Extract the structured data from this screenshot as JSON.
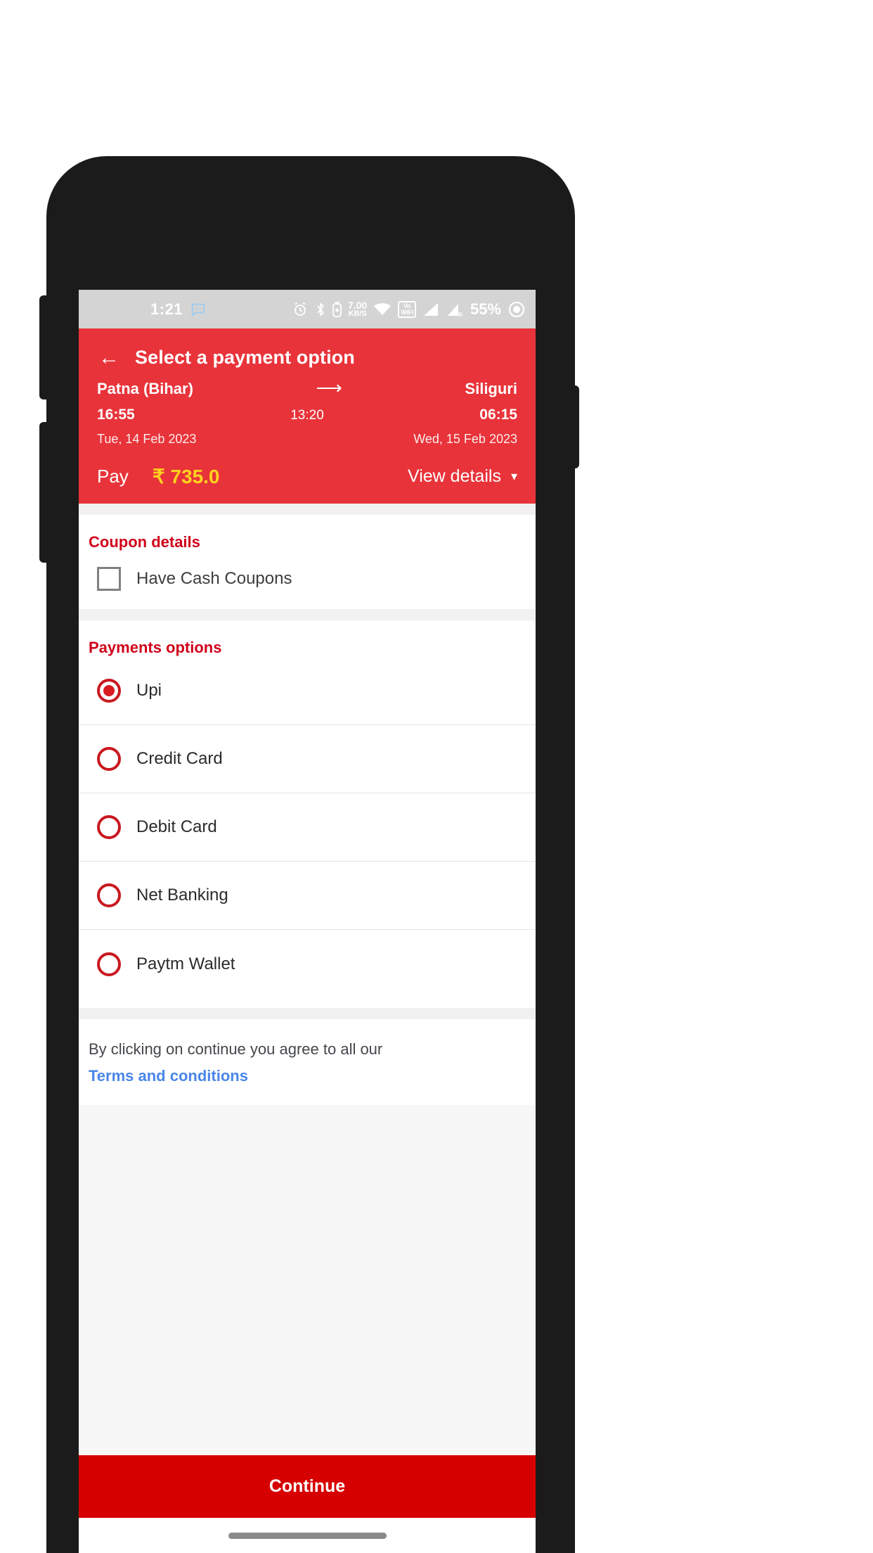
{
  "status_bar": {
    "time": "1:21",
    "message_icon": "message-bubble-icon",
    "alarm_icon": "alarm-clock-icon",
    "bluetooth_icon": "bluetooth-icon",
    "data_rate_value": "7.00",
    "data_rate_unit": "KB/S",
    "wifi_icon": "wifi-icon",
    "vowifi_line1": "Vo",
    "vowifi_line2": "WiFi",
    "vowifi_sim": "1",
    "signal_icon_1": "cellular-signal-icon",
    "signal_icon_2": "cellular-signal-roaming-icon",
    "battery_percent": "55%",
    "battery_icon": "battery-circle-icon"
  },
  "app_bar": {
    "back_icon": "back-arrow-icon",
    "title": "Select a payment option"
  },
  "journey": {
    "origin_city": "Patna (Bihar)",
    "arrow_icon": "right-arrow-icon",
    "destination_city": "Siliguri",
    "departure_time": "16:55",
    "duration": "13:20",
    "arrival_time": "06:15",
    "departure_date": "Tue, 14 Feb 2023",
    "arrival_date": "Wed, 15 Feb 2023"
  },
  "pay_bar": {
    "pay_label": "Pay",
    "currency_symbol": "₹",
    "amount": "735.0",
    "view_details_label": "View details",
    "chevron_icon": "chevron-down-icon"
  },
  "coupon": {
    "section_title": "Coupon details",
    "checkbox_label": "Have Cash Coupons",
    "checked": false
  },
  "payments": {
    "section_title": "Payments options",
    "options": [
      {
        "label": "Upi",
        "selected": true
      },
      {
        "label": "Credit Card",
        "selected": false
      },
      {
        "label": "Debit Card",
        "selected": false
      },
      {
        "label": "Net Banking",
        "selected": false
      },
      {
        "label": "Paytm Wallet",
        "selected": false
      }
    ]
  },
  "terms": {
    "text": "By clicking on continue you agree to all our",
    "link_label": "Terms and conditions"
  },
  "footer": {
    "continue_label": "Continue"
  },
  "colors": {
    "header_red": "#e8333a",
    "button_red": "#d60000",
    "section_title_red": "#d0021b",
    "amount_yellow": "#ffd21e",
    "link_blue": "#4a86e8",
    "radio_red": "#c9181f"
  }
}
